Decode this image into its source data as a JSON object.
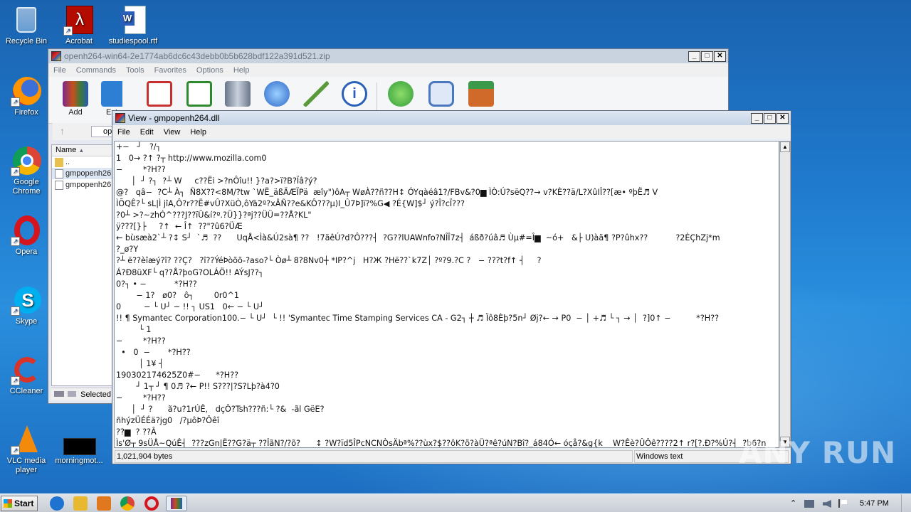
{
  "desktop": {
    "icons": [
      {
        "label": "Recycle Bin",
        "icon": "recycle-bin-icon"
      },
      {
        "label": "Acrobat",
        "icon": "acrobat-icon"
      },
      {
        "label": "studiespool.rtf",
        "icon": "word-document-icon"
      },
      {
        "label": "Firefox",
        "icon": "firefox-icon"
      },
      {
        "label": "Google Chrome",
        "icon": "chrome-icon"
      },
      {
        "label": "Opera",
        "icon": "opera-icon"
      },
      {
        "label": "Skype",
        "icon": "skype-icon"
      },
      {
        "label": "CCleaner",
        "icon": "ccleaner-icon"
      },
      {
        "label": "VLC media player",
        "icon": "vlc-icon"
      },
      {
        "label": "morningmot...",
        "icon": "black-file-icon"
      }
    ]
  },
  "rar_window": {
    "title": "openh264-win64-2e1774ab6dc6c43debb0b5b628bdf122a391d521.zip",
    "menu": [
      "File",
      "Commands",
      "Tools",
      "Favorites",
      "Options",
      "Help"
    ],
    "toolbar": [
      {
        "label": "Add",
        "icon": "archive-add-icon",
        "color": "#c8501e"
      },
      {
        "label": "Ext",
        "icon": "extract-folder-icon",
        "color": "#2d7fd3"
      },
      {
        "label": "",
        "icon": "test-clipboard-icon",
        "color": "#c83030"
      },
      {
        "label": "",
        "icon": "view-book-icon",
        "color": "#2f8a2f"
      },
      {
        "label": "",
        "icon": "delete-bin-icon",
        "color": "#8a96a8"
      },
      {
        "label": "",
        "icon": "find-magnifier-icon",
        "color": "#2b67c8"
      },
      {
        "label": "",
        "icon": "wizard-wand-icon",
        "color": "#5a9a3a"
      },
      {
        "label": "",
        "icon": "info-icon",
        "color": "#2c5fb8"
      },
      {
        "label": "",
        "icon": "virus-scan-icon",
        "color": "#2f9d3a"
      },
      {
        "label": "",
        "icon": "comment-icon",
        "color": "#4a78c0"
      },
      {
        "label": "",
        "icon": "sfx-box-icon",
        "color": "#d06a2a"
      }
    ],
    "address": "op",
    "column_name": "Name",
    "files": [
      "..",
      "gmpopenh26",
      "gmpopenh26"
    ],
    "status": "Selected"
  },
  "viewer": {
    "title": "View - gmpopenh264.dll",
    "menu": [
      "File",
      "Edit",
      "View",
      "Help"
    ],
    "content": "+−   ┘   ?/┐\n1   0→ ?↑ ?┬ http://www.mozilla.com0\n−        *?H??\n      │  ┘ ?┐  ?┴ W     c??Ëi >?nÔîu!! }?a?>ï?B?Ïâ?ý?\n@?   qâ−  ?C┴ À┐  Ñ8X??<8M/?tw `WË_äßÄÆÏPä  æîy\")ôA┬ WøÀ??ñ??H↕ ÓYqàéâ1?/FBv&?0▆ ÌÒ:Ú?sëQ??→ v?KÈ??ä/L?XûIÎ??[æ• ºþË♬ V\nÌÕQÊ?└ sL|Ì jîA,Ô?r??Ë#vÛ?XüÒ,ôYä2º?xÂÑ??e&KÔ???µ)I_Û7Þ]ï?%G◀ ?É{W]$┘ ý?Î?cÏ???\n?0┴ >?~zhÓ^???J??ïÜ&í?º.?Ü}}?ªj??ÜÜ=??Å?KL\"\nÿ???[}├     ?↑  ← Î↑  ??\"?û6?ÜÆ\n← bùsæà2`┴ ?↕ S┘  `♬  ??      UqÅ<Ìà&Ú2sà¶ ??   !7äêÚ?d?Ô???┤  ?G??lUAWnfo?NÎÎ7z┤  áßð?úâ♬ Ùµ#=Î▆  ~ó+   &├ U)àä¶ ?P?ûhx??           ?2ÈÇhZj*m\n?_ø?Y\n?┴ ë??èîæý?î? ??Ç?   ?î??ÝéÞòõõ-?aso?└ Òø┴ 8?8Nv0┼ *IP?^j   H?Ж ?Hë??`k7Z│ ?º?9.?C ?   − ???t?f↑ ┤     ?\nÁ?Ð8üXF└ q??Å?þoG?OLÁÖ!! AÝsJ??┐\n0?┐ • −           *?H??\n        − 1?   ø0?   ô┐        0r0^1\n0         − └ U┘ − !! ┐ US1   0← − └ U┘\n!! ¶ Symantec Corporation100.− └ U┘  └ !! 'Symantec Time Stamping Services CA - G2┐ ┼ ♬ Ïô8Èþ?5n┘ Øj?← → P0  − │ +♬ └ ┐ → │  ?]0↑ −          *?H??\n         └ 1\n−        *?H??\n  •   0  −       *?H??\n         │ 1¥ ┤\n190302174625Z0#−      *?H??\n        ┘ 1┬ ┘ ¶ 0♬ ?← P!! S???|?S?Lþ?à4?0\n−        *?H??\n      │  ┘ ?      ã?u?1rÚÊ,   dçÔ?Tsh???ñ:└ ?&  -ãl GëE?\nñhýzÜÉÉä?jg0   /?µôÞ?Ôêî\n??▆  ? ??Â\nÌs'Ø┬ 9sÜÅ~QúÊ┤  ???zGn|Ë??G?ä┬ ??ÎãN?/?õ?      ↕ ?W?ïd5ÎPcNCNÒsÄbª%??ùx?$??ôK?õ?àÜ?ªê?úN?Bî?_á84Ó← óçå?&g{k    W?Êè?ÛÔê????2↑ r?[?.Ð?%Ú?┤  ?b6?n",
    "status_bytes": "1,021,904 bytes",
    "status_encoding": "Windows text"
  },
  "taskbar": {
    "start_label": "Start",
    "pinned": [
      {
        "icon": "ie-icon",
        "color": "#1e73d0"
      },
      {
        "icon": "explorer-icon",
        "color": "#e8b830"
      },
      {
        "icon": "media-player-icon",
        "color": "#e07820"
      },
      {
        "icon": "chrome-icon",
        "color": "#3aa757"
      },
      {
        "icon": "opera-icon",
        "color": "#d5141e"
      },
      {
        "icon": "winrar-icon",
        "color": "#8b1f3a"
      }
    ],
    "clock": "5:47 PM"
  },
  "watermark": "ANY RUN"
}
